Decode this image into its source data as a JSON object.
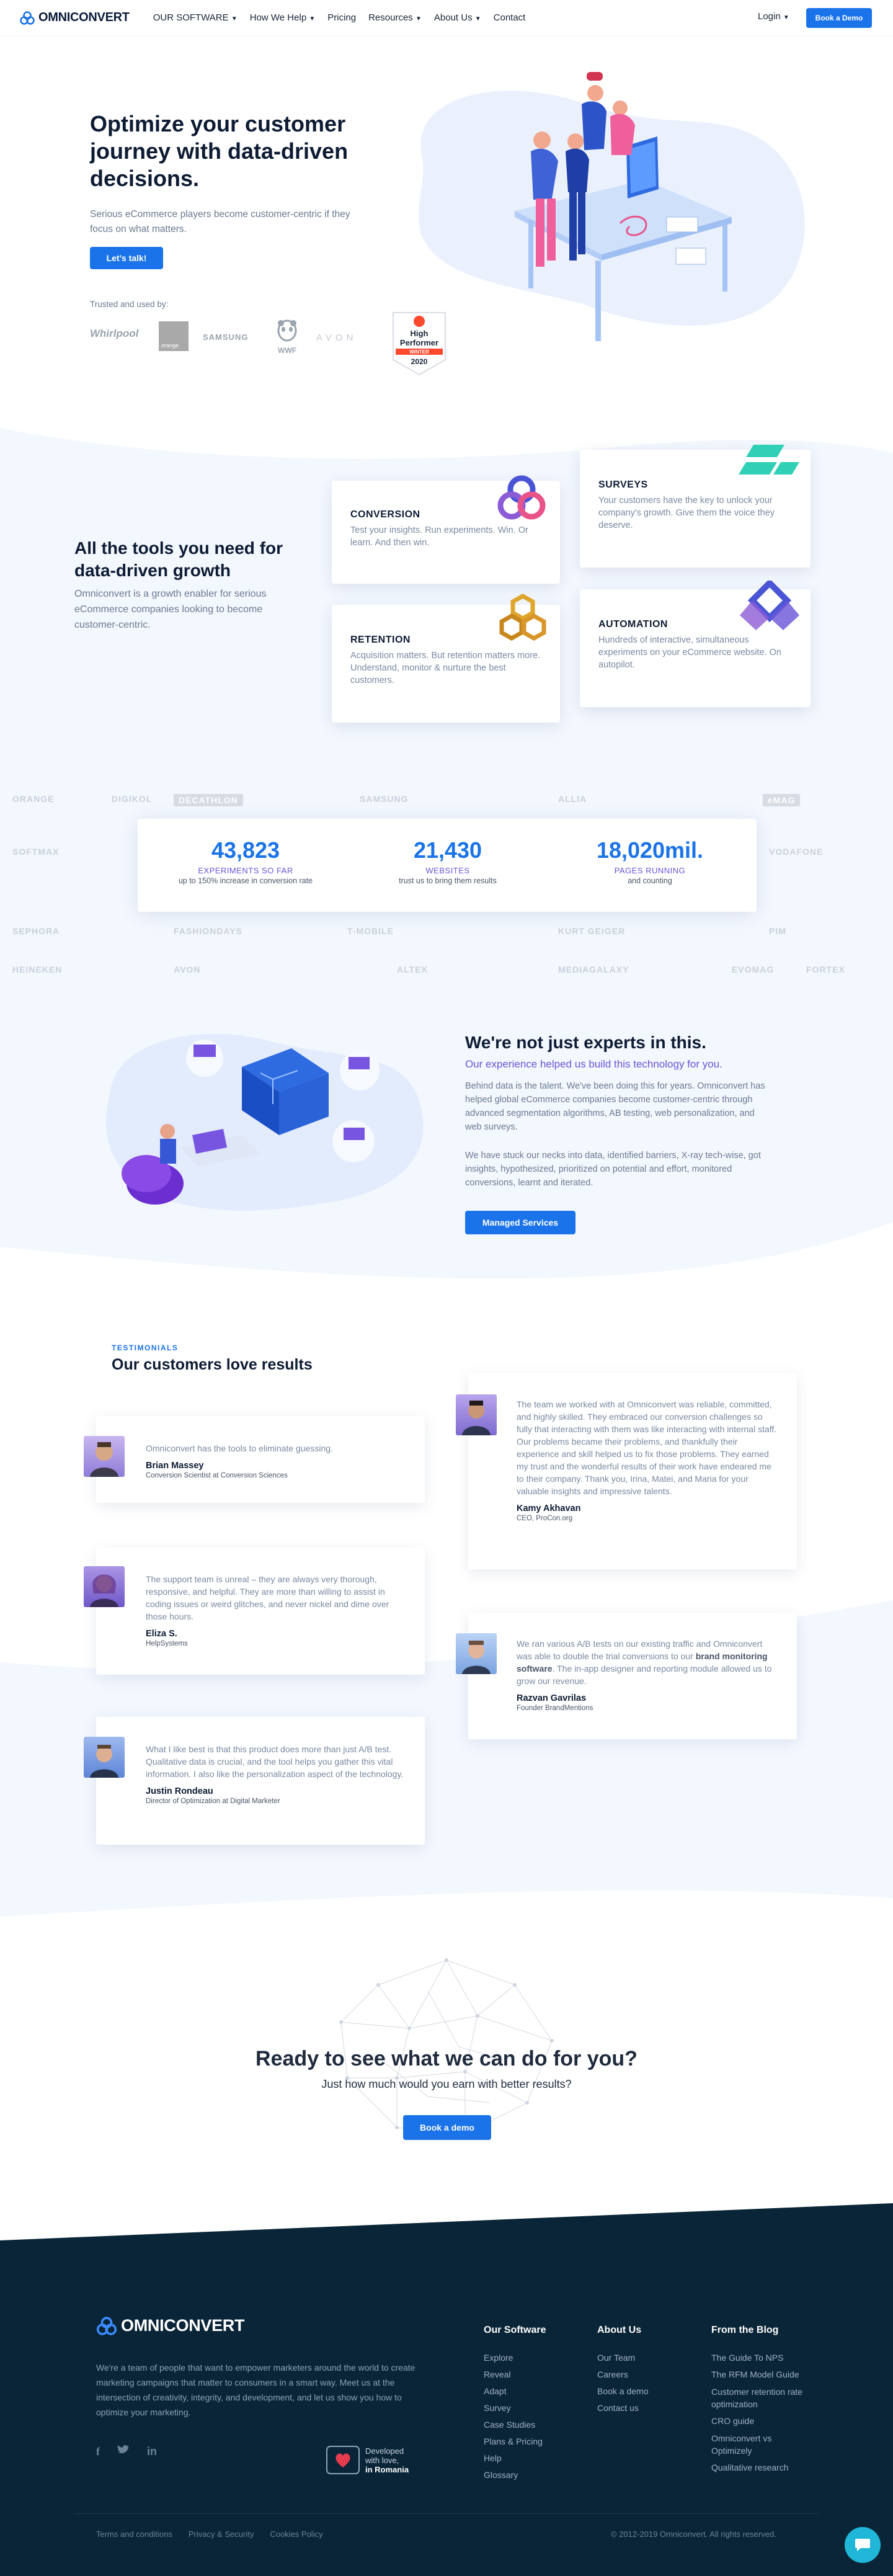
{
  "nav": {
    "brand": "OMNICONVERT",
    "links": [
      "OUR SOFTWARE",
      "How We Help",
      "Pricing",
      "Resources",
      "About Us",
      "Contact"
    ],
    "has_dropdown": [
      true,
      true,
      false,
      true,
      true,
      false
    ],
    "login": "Login",
    "cta": "Book a Demo"
  },
  "hero": {
    "title": "Optimize your customer journey with data-driven decisions.",
    "subtitle": "Serious eCommerce players become customer-centric if they focus on what matters.",
    "cta": "Let's talk!",
    "trusted": "Trusted and used by:",
    "logos": [
      "Whirlpool",
      "orange",
      "SAMSUNG",
      "WWF",
      "AVON"
    ],
    "badge": {
      "top": "High",
      "main": "Performer",
      "season": "WINTER",
      "year": "2020"
    }
  },
  "tools": {
    "title": "All the tools you need for data-driven growth",
    "text": "Omniconvert is a growth enabler for serious eCommerce companies looking to become customer-centric.",
    "cards": [
      {
        "title": "CONVERSION",
        "text": "Test your insights. Run experiments. Win. Or learn. And then win."
      },
      {
        "title": "SURVEYS",
        "text": "Your customers have the key to unlock your company's growth. Give them the voice they deserve."
      },
      {
        "title": "RETENTION",
        "text": "Acquisition matters. But retention matters more. Understand, monitor & nurture the best customers."
      },
      {
        "title": "AUTOMATION",
        "text": "Hundreds of interactive, simultaneous experiments on your eCommerce website. On autopilot."
      }
    ]
  },
  "clients": {
    "row1": [
      "ORANGE",
      "DIGIKOL",
      "DECATHLON",
      "SAMSUNG",
      "ALLIA",
      "eMAG",
      "SEPHORA",
      "T-MOBILE",
      "AVON",
      "PIM"
    ],
    "row2": [
      "SOFTMAX",
      "HEINEKEN",
      "FASHIONDAYS",
      "VODAFONE",
      "KURT GEIGER",
      "ALTEX",
      "MEDIAGALAXY",
      "EVOMAG",
      "FORTEX",
      "BRANDO"
    ]
  },
  "stats": [
    {
      "num": "43,823",
      "label": "EXPERIMENTS SO FAR",
      "sub": "up to 150% increase in conversion rate"
    },
    {
      "num": "21,430",
      "label": "WEBSITES",
      "sub": "trust us to bring them results"
    },
    {
      "num": "18,020mil.",
      "label": "PAGES RUNNING",
      "sub": "and counting"
    }
  ],
  "experts": {
    "title": "We're not just experts in this.",
    "subtitle": "Our experience helped us build this technology for you.",
    "p1": "Behind data is the talent. We've been doing this for years. Omniconvert has helped global eCommerce companies become customer-centric through advanced segmentation algorithms, AB testing, web personalization, and web surveys.",
    "p2": "We have stuck our necks into data, identified barriers, X-ray tech-wise, got insights, hypothesized, prioritized on potential and effort, monitored conversions, learnt and iterated.",
    "cta": "Managed Services"
  },
  "testimonials": {
    "eyebrow": "TESTIMONIALS",
    "title": "Our customers love results",
    "items": [
      {
        "text": "Omniconvert has the tools to eliminate guessing.",
        "name": "Brian Massey",
        "role": "Conversion Scientist at Conversion Sciences"
      },
      {
        "text": "The team we worked with at Omniconvert was reliable, committed, and highly skilled. They embraced our conversion challenges so fully that interacting with them was like interacting with internal staff. Our problems became their problems, and thankfully their experience and skill helped us to fix those problems. They earned my trust and the wonderful results of their work have endeared me to their company. Thank you, Irina, Matei, and Maria for your valuable insights and impressive talents.",
        "name": "Kamy Akhavan",
        "role": "CEO, ProCon.org"
      },
      {
        "text": "The support team is unreal – they are always very thorough, responsive, and helpful. They are more than willing to assist in coding issues or weird glitches, and never nickel and dime over those hours.",
        "name": "Eliza S.",
        "role": "HelpSystems"
      },
      {
        "text_before": "We ran various A/B tests on our existing traffic and Omniconvert was able to double the trial conversions to our ",
        "text_bold": "brand monitoring software",
        "text_after": ". The in-app designer and reporting module allowed us to grow our revenue.",
        "name": "Razvan Gavrilas",
        "role": "Founder BrandMentions"
      },
      {
        "text": "What I like best is that this product does more than just A/B test. Qualitative data is crucial, and the tool helps you gather this vital information. I also like the personalization aspect of the technology.",
        "name": "Justin Rondeau",
        "role": "Director of Optimization at Digital Marketer"
      }
    ]
  },
  "cta_section": {
    "title": "Ready to see what we can do for you?",
    "subtitle": "Just how much would you earn with better results?",
    "button": "Book a demo"
  },
  "footer": {
    "brand": "OMNICONVERT",
    "about": "We're a team of people that want to empower marketers around the world to create marketing campaigns that matter to consumers in a smart way. Meet us at the intersection of creativity, integrity, and development, and let us show you how to optimize your marketing.",
    "developed_line1": "Developed",
    "developed_line2": "with love,",
    "developed_line3": "in Romania",
    "columns": [
      {
        "title": "Our Software",
        "items": [
          "Explore",
          "Reveal",
          "Adapt",
          "Survey",
          "Case Studies",
          "Plans & Pricing",
          "Help",
          "Glossary"
        ]
      },
      {
        "title": "About Us",
        "items": [
          "Our Team",
          "Careers",
          "Book a demo",
          "Contact us"
        ]
      },
      {
        "title": "From the Blog",
        "items": [
          "The Guide To NPS",
          "The RFM Model Guide",
          "Customer retention rate optimization",
          "CRO guide",
          "Omniconvert vs Optimizely",
          "Qualitative research"
        ]
      }
    ],
    "legal": [
      "Terms and conditions",
      "Privacy & Security",
      "Cookies Policy"
    ],
    "copyright": "© 2012-2019 Omniconvert. All rights reserved."
  },
  "colors": {
    "accent": "#1a73e8",
    "navy": "#0a2537",
    "purple": "#6a54d8"
  }
}
